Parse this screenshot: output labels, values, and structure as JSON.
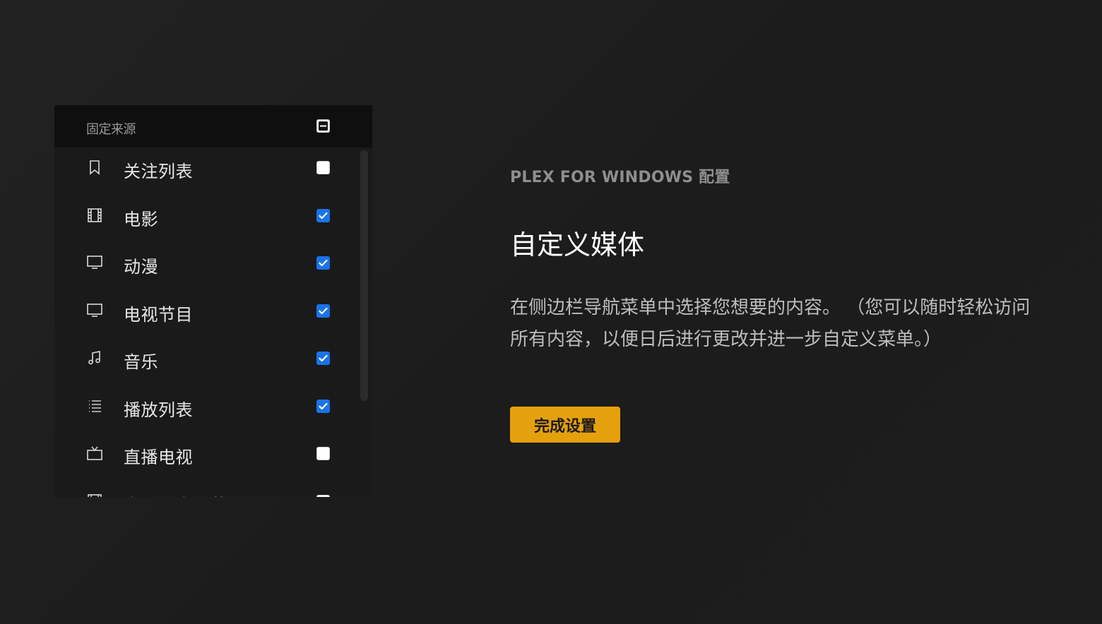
{
  "sidebar": {
    "header": {
      "title": "固定来源",
      "checkbox_state": "mixed"
    },
    "items": [
      {
        "label": "关注列表",
        "icon": "bookmark-icon",
        "checked": false
      },
      {
        "label": "电影",
        "icon": "film-icon",
        "checked": true
      },
      {
        "label": "动漫",
        "icon": "monitor-icon",
        "checked": true
      },
      {
        "label": "电视节目",
        "icon": "monitor-icon",
        "checked": true
      },
      {
        "label": "音乐",
        "icon": "music-note-icon",
        "checked": true
      },
      {
        "label": "播放列表",
        "icon": "list-icon",
        "checked": true
      },
      {
        "label": "直播电视",
        "icon": "tv-antenna-icon",
        "checked": false
      },
      {
        "label": "电影和电视节目",
        "icon": "film-icon",
        "checked": false
      }
    ]
  },
  "main": {
    "subtitle": "PLEX FOR WINDOWS 配置",
    "heading": "自定义媒体",
    "description": "在侧边栏导航菜单中选择您想要的内容。 （您可以随时轻松访问所有内容，以便日后进行更改并进一步自定义菜单。）",
    "finish_button": "完成设置"
  },
  "colors": {
    "accent": "#e5a00d",
    "checkbox_checked": "#1a73e8",
    "background": "#1e1e1e"
  }
}
